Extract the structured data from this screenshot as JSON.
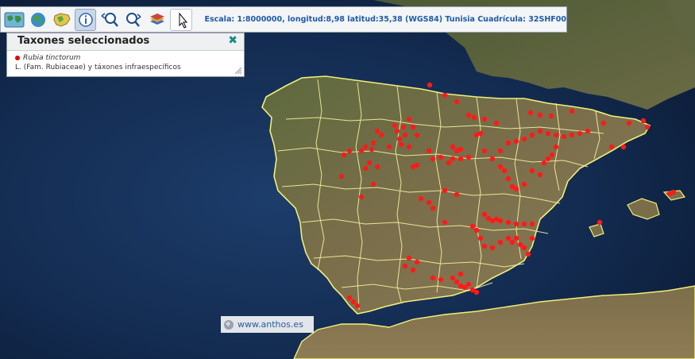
{
  "toolbar": {
    "tools": [
      {
        "name": "overview-map",
        "icon": "world-map-icon"
      },
      {
        "name": "globe",
        "icon": "globe-icon"
      },
      {
        "name": "spain-map",
        "icon": "spain-map-icon"
      },
      {
        "name": "info",
        "icon": "info-icon",
        "active": true
      },
      {
        "name": "zoom-out",
        "icon": "zoom-out-icon"
      },
      {
        "name": "zoom-in",
        "icon": "zoom-in-icon"
      },
      {
        "name": "layers",
        "icon": "layers-icon"
      },
      {
        "name": "select-arrow",
        "icon": "select-arrow-icon"
      }
    ],
    "status_text": "Escala: 1:8000000, longitud:8,98 latitud:35,38 (WGS84) Tunisia Cuadrícula: 32SHF00"
  },
  "panel": {
    "title": "Taxones seleccionados",
    "close_symbol": "✖",
    "taxon_name": "Rubia tinctorum",
    "taxon_rest": "L. (Fam. Rubiaceae) y táxones infraespecíficos",
    "marker_color": "#e00000"
  },
  "credit": {
    "text": "www.anthos.es"
  },
  "map": {
    "colors": {
      "sea": "#12284a",
      "land": "#6b6a45",
      "border": "#f2ef7a",
      "occurrence": "#ff1a1a"
    },
    "occurrences": "Rubia tinctorum"
  }
}
